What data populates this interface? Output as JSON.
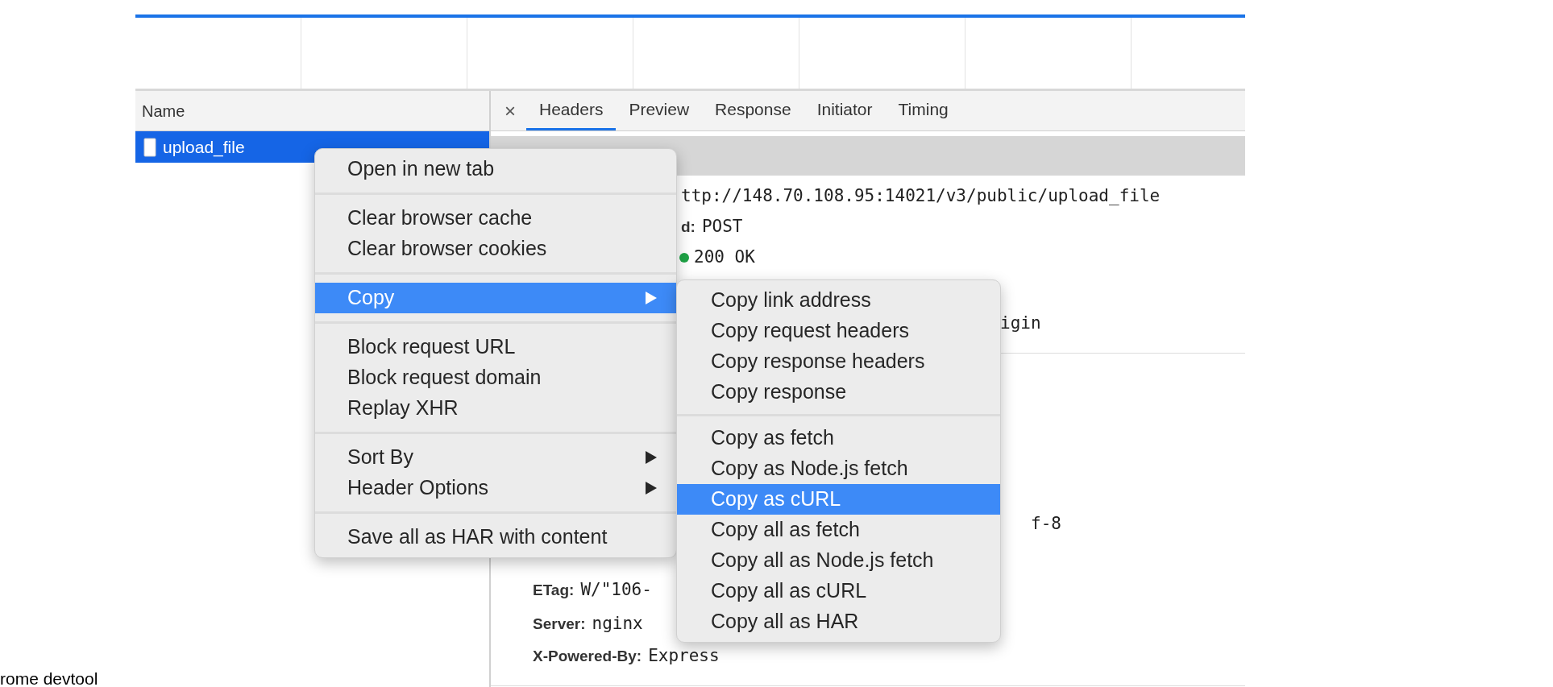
{
  "name_column": {
    "header": "Name",
    "rows": [
      {
        "name": "upload_file",
        "selected": true
      }
    ]
  },
  "detail_close": "×",
  "tabs": [
    {
      "label": "Headers",
      "selected": true
    },
    {
      "label": "Preview",
      "selected": false
    },
    {
      "label": "Response",
      "selected": false
    },
    {
      "label": "Initiator",
      "selected": false
    },
    {
      "label": "Timing",
      "selected": false
    }
  ],
  "details": [
    {
      "kind": "fragment",
      "value": "ttp://148.70.108.95:14021/v3/public/upload_file"
    },
    {
      "kind": "header",
      "label": "d:",
      "value": "POST"
    },
    {
      "kind": "status",
      "color": "#1ea446",
      "value": "200 OK"
    },
    {
      "kind": "fragment",
      "value": "igin"
    },
    {
      "kind": "fragment",
      "value": "f-8"
    },
    {
      "kind": "header",
      "label": "ETag:",
      "value": "W/\"106-"
    },
    {
      "kind": "header",
      "label": "Server:",
      "value": "nginx"
    },
    {
      "kind": "header",
      "label": "X-Powered-By:",
      "value": "Express"
    }
  ],
  "context_menu": [
    [
      {
        "label": "Open in new tab",
        "selected": false,
        "has_submenu": false
      }
    ],
    [
      {
        "label": "Clear browser cache",
        "selected": false,
        "has_submenu": false
      },
      {
        "label": "Clear browser cookies",
        "selected": false,
        "has_submenu": false
      }
    ],
    [
      {
        "label": "Copy",
        "selected": true,
        "has_submenu": true
      }
    ],
    [
      {
        "label": "Block request URL",
        "selected": false,
        "has_submenu": false
      },
      {
        "label": "Block request domain",
        "selected": false,
        "has_submenu": false
      },
      {
        "label": "Replay XHR",
        "selected": false,
        "has_submenu": false
      }
    ],
    [
      {
        "label": "Sort By",
        "selected": false,
        "has_submenu": true
      },
      {
        "label": "Header Options",
        "selected": false,
        "has_submenu": true
      }
    ],
    [
      {
        "label": "Save all as HAR with content",
        "selected": false,
        "has_submenu": false
      }
    ]
  ],
  "copy_submenu": [
    [
      {
        "label": "Copy link address",
        "selected": false
      },
      {
        "label": "Copy request headers",
        "selected": false
      },
      {
        "label": "Copy response headers",
        "selected": false
      },
      {
        "label": "Copy response",
        "selected": false
      }
    ],
    [
      {
        "label": "Copy as fetch",
        "selected": false
      },
      {
        "label": "Copy as Node.js fetch",
        "selected": false
      },
      {
        "label": "Copy as cURL",
        "selected": true
      },
      {
        "label": "Copy all as fetch",
        "selected": false
      },
      {
        "label": "Copy all as Node.js fetch",
        "selected": false
      },
      {
        "label": "Copy all as cURL",
        "selected": false
      },
      {
        "label": "Copy all as HAR",
        "selected": false
      }
    ]
  ],
  "caption": "rome devtool"
}
